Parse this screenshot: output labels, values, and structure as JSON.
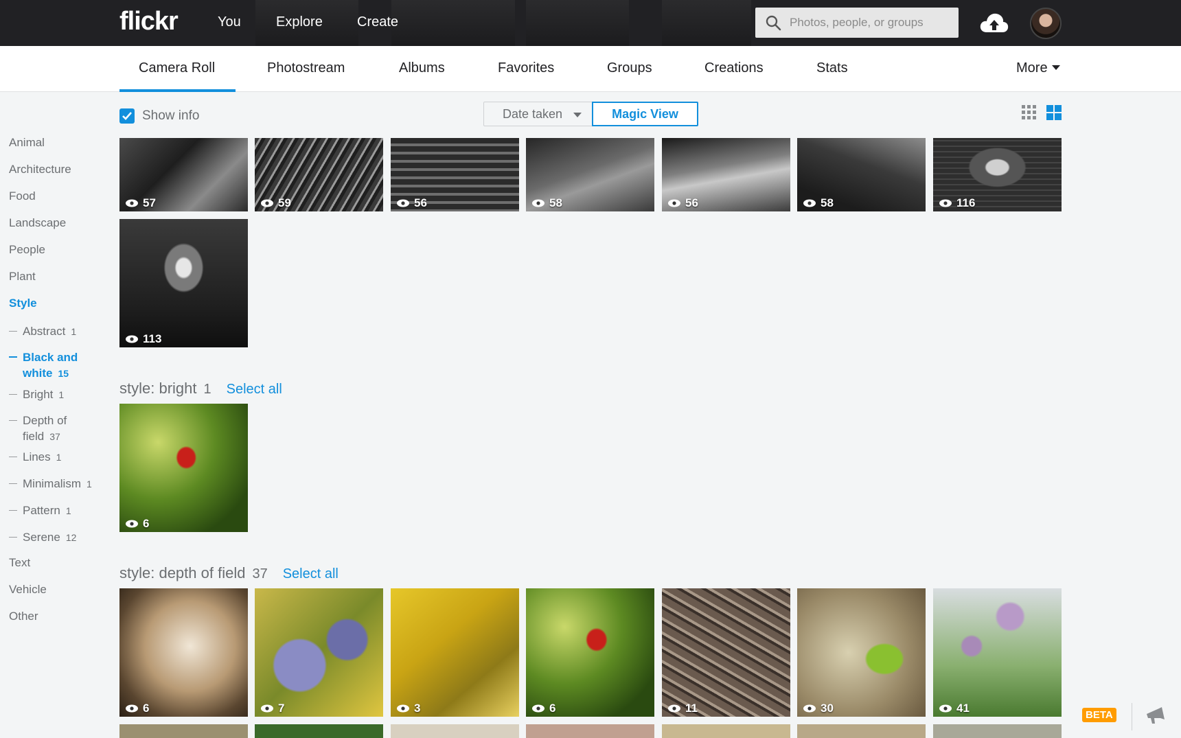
{
  "topbar": {
    "logo": "flickr",
    "nav": [
      "You",
      "Explore",
      "Create"
    ],
    "search_placeholder": "Photos, people, or groups",
    "icons": {
      "search": "search-icon",
      "upload": "cloud-upload-icon",
      "avatar": "avatar"
    }
  },
  "tabs": [
    "Camera Roll",
    "Photostream",
    "Albums",
    "Favorites",
    "Groups",
    "Creations",
    "Stats"
  ],
  "more_label": "More",
  "controls": {
    "show_info": "Show info",
    "date_taken": "Date taken",
    "magic_view": "Magic View"
  },
  "sidebar": {
    "categories": [
      "Animal",
      "Architecture",
      "Food",
      "Landscape",
      "People",
      "Plant",
      "Style"
    ],
    "style_subs": [
      {
        "label": "Abstract",
        "count": "1"
      },
      {
        "label": "Black and",
        "label2": "white",
        "count": "15"
      },
      {
        "label": "Bright",
        "count": "1"
      },
      {
        "label": "Depth of",
        "label2": "field",
        "count": "37"
      },
      {
        "label": "Lines",
        "count": "1"
      },
      {
        "label": "Minimalism",
        "count": "1"
      },
      {
        "label": "Pattern",
        "count": "1"
      },
      {
        "label": "Serene",
        "count": "12"
      }
    ],
    "trailing": [
      "Text",
      "Vehicle",
      "Other"
    ]
  },
  "bw_photos": [
    "57",
    "59",
    "56",
    "58",
    "56",
    "58",
    "116",
    "113"
  ],
  "bright": {
    "title": "style: bright",
    "count": "1",
    "select_all": "Select all",
    "photos": [
      "6"
    ]
  },
  "dof": {
    "title": "style: depth of field",
    "count": "37",
    "select_all": "Select all",
    "photos": [
      "6",
      "7",
      "3",
      "6",
      "11",
      "30",
      "41"
    ]
  },
  "beta": "BETA",
  "colors": {
    "accent": "#128fdc",
    "topbar": "#212124",
    "beta": "#ff9c00"
  }
}
